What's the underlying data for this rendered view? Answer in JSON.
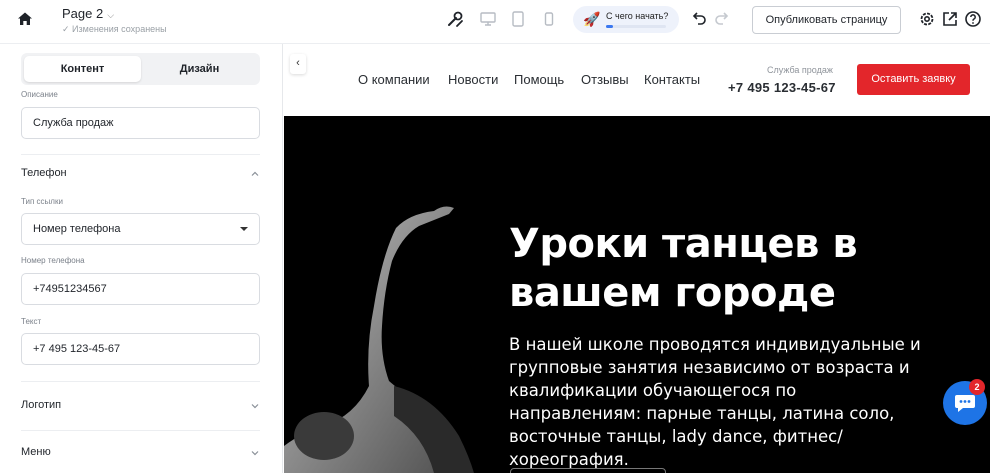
{
  "topbar": {
    "page_name": "Page 2",
    "saved_status": "✓ Изменения сохранены",
    "start_label": "С чего начать?",
    "start_progress": 0.12,
    "publish_label": "Опубликовать страницу",
    "icons": [
      "home-icon",
      "chevron-down-icon",
      "paint-tools-icon",
      "desktop-icon",
      "tablet-icon",
      "mobile-icon",
      "rocket-icon",
      "undo-icon",
      "redo-icon",
      "gear-icon",
      "external-link-icon",
      "help-icon"
    ]
  },
  "sidebar": {
    "tabs": {
      "content": "Контент",
      "design": "Дизайн"
    },
    "description_label": "Описание",
    "description_value": "Служба продаж",
    "phone_section": "Телефон",
    "link_type_label": "Тип ссылки",
    "link_type_value": "Номер телефона",
    "phone_number_label": "Номер телефона",
    "phone_number_value": "+74951234567",
    "text_label": "Текст",
    "text_value": "+7 495 123-45-67",
    "logo_section": "Логотип",
    "menu_section": "Меню"
  },
  "site": {
    "nav": [
      "О компании",
      "Новости",
      "Помощь",
      "Отзывы",
      "Контакты"
    ],
    "service_label": "Служба продаж",
    "phone": "+7 495 123-45-67",
    "cta": "Оставить заявку",
    "hero_title": "Уроки танцев в вашем городе",
    "hero_text": "В нашей школе проводятся индивидуальные и групповые занятия независимо от возраста и квалификации обучающегося по направлениям: парные танцы, латина соло, восточные танцы, lady dance, фитнес/хореография."
  },
  "chat": {
    "badge": "2"
  },
  "colors": {
    "accent": "#e3262b",
    "chat": "#1e74e6",
    "hero_bg": "#000000"
  }
}
